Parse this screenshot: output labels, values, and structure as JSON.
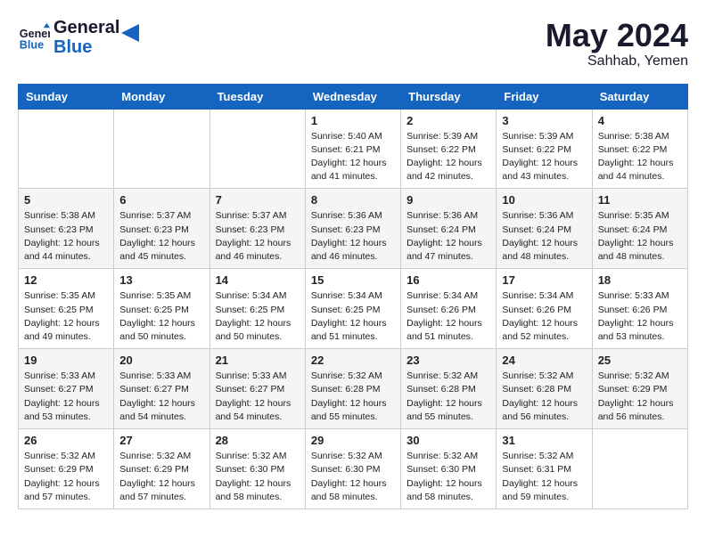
{
  "logo": {
    "line1": "General",
    "line2": "Blue"
  },
  "title": "May 2024",
  "subtitle": "Sahhab, Yemen",
  "weekdays": [
    "Sunday",
    "Monday",
    "Tuesday",
    "Wednesday",
    "Thursday",
    "Friday",
    "Saturday"
  ],
  "weeks": [
    [
      {
        "day": "",
        "info": ""
      },
      {
        "day": "",
        "info": ""
      },
      {
        "day": "",
        "info": ""
      },
      {
        "day": "1",
        "info": "Sunrise: 5:40 AM\nSunset: 6:21 PM\nDaylight: 12 hours\nand 41 minutes."
      },
      {
        "day": "2",
        "info": "Sunrise: 5:39 AM\nSunset: 6:22 PM\nDaylight: 12 hours\nand 42 minutes."
      },
      {
        "day": "3",
        "info": "Sunrise: 5:39 AM\nSunset: 6:22 PM\nDaylight: 12 hours\nand 43 minutes."
      },
      {
        "day": "4",
        "info": "Sunrise: 5:38 AM\nSunset: 6:22 PM\nDaylight: 12 hours\nand 44 minutes."
      }
    ],
    [
      {
        "day": "5",
        "info": "Sunrise: 5:38 AM\nSunset: 6:23 PM\nDaylight: 12 hours\nand 44 minutes."
      },
      {
        "day": "6",
        "info": "Sunrise: 5:37 AM\nSunset: 6:23 PM\nDaylight: 12 hours\nand 45 minutes."
      },
      {
        "day": "7",
        "info": "Sunrise: 5:37 AM\nSunset: 6:23 PM\nDaylight: 12 hours\nand 46 minutes."
      },
      {
        "day": "8",
        "info": "Sunrise: 5:36 AM\nSunset: 6:23 PM\nDaylight: 12 hours\nand 46 minutes."
      },
      {
        "day": "9",
        "info": "Sunrise: 5:36 AM\nSunset: 6:24 PM\nDaylight: 12 hours\nand 47 minutes."
      },
      {
        "day": "10",
        "info": "Sunrise: 5:36 AM\nSunset: 6:24 PM\nDaylight: 12 hours\nand 48 minutes."
      },
      {
        "day": "11",
        "info": "Sunrise: 5:35 AM\nSunset: 6:24 PM\nDaylight: 12 hours\nand 48 minutes."
      }
    ],
    [
      {
        "day": "12",
        "info": "Sunrise: 5:35 AM\nSunset: 6:25 PM\nDaylight: 12 hours\nand 49 minutes."
      },
      {
        "day": "13",
        "info": "Sunrise: 5:35 AM\nSunset: 6:25 PM\nDaylight: 12 hours\nand 50 minutes."
      },
      {
        "day": "14",
        "info": "Sunrise: 5:34 AM\nSunset: 6:25 PM\nDaylight: 12 hours\nand 50 minutes."
      },
      {
        "day": "15",
        "info": "Sunrise: 5:34 AM\nSunset: 6:25 PM\nDaylight: 12 hours\nand 51 minutes."
      },
      {
        "day": "16",
        "info": "Sunrise: 5:34 AM\nSunset: 6:26 PM\nDaylight: 12 hours\nand 51 minutes."
      },
      {
        "day": "17",
        "info": "Sunrise: 5:34 AM\nSunset: 6:26 PM\nDaylight: 12 hours\nand 52 minutes."
      },
      {
        "day": "18",
        "info": "Sunrise: 5:33 AM\nSunset: 6:26 PM\nDaylight: 12 hours\nand 53 minutes."
      }
    ],
    [
      {
        "day": "19",
        "info": "Sunrise: 5:33 AM\nSunset: 6:27 PM\nDaylight: 12 hours\nand 53 minutes."
      },
      {
        "day": "20",
        "info": "Sunrise: 5:33 AM\nSunset: 6:27 PM\nDaylight: 12 hours\nand 54 minutes."
      },
      {
        "day": "21",
        "info": "Sunrise: 5:33 AM\nSunset: 6:27 PM\nDaylight: 12 hours\nand 54 minutes."
      },
      {
        "day": "22",
        "info": "Sunrise: 5:32 AM\nSunset: 6:28 PM\nDaylight: 12 hours\nand 55 minutes."
      },
      {
        "day": "23",
        "info": "Sunrise: 5:32 AM\nSunset: 6:28 PM\nDaylight: 12 hours\nand 55 minutes."
      },
      {
        "day": "24",
        "info": "Sunrise: 5:32 AM\nSunset: 6:28 PM\nDaylight: 12 hours\nand 56 minutes."
      },
      {
        "day": "25",
        "info": "Sunrise: 5:32 AM\nSunset: 6:29 PM\nDaylight: 12 hours\nand 56 minutes."
      }
    ],
    [
      {
        "day": "26",
        "info": "Sunrise: 5:32 AM\nSunset: 6:29 PM\nDaylight: 12 hours\nand 57 minutes."
      },
      {
        "day": "27",
        "info": "Sunrise: 5:32 AM\nSunset: 6:29 PM\nDaylight: 12 hours\nand 57 minutes."
      },
      {
        "day": "28",
        "info": "Sunrise: 5:32 AM\nSunset: 6:30 PM\nDaylight: 12 hours\nand 58 minutes."
      },
      {
        "day": "29",
        "info": "Sunrise: 5:32 AM\nSunset: 6:30 PM\nDaylight: 12 hours\nand 58 minutes."
      },
      {
        "day": "30",
        "info": "Sunrise: 5:32 AM\nSunset: 6:30 PM\nDaylight: 12 hours\nand 58 minutes."
      },
      {
        "day": "31",
        "info": "Sunrise: 5:32 AM\nSunset: 6:31 PM\nDaylight: 12 hours\nand 59 minutes."
      },
      {
        "day": "",
        "info": ""
      }
    ]
  ]
}
